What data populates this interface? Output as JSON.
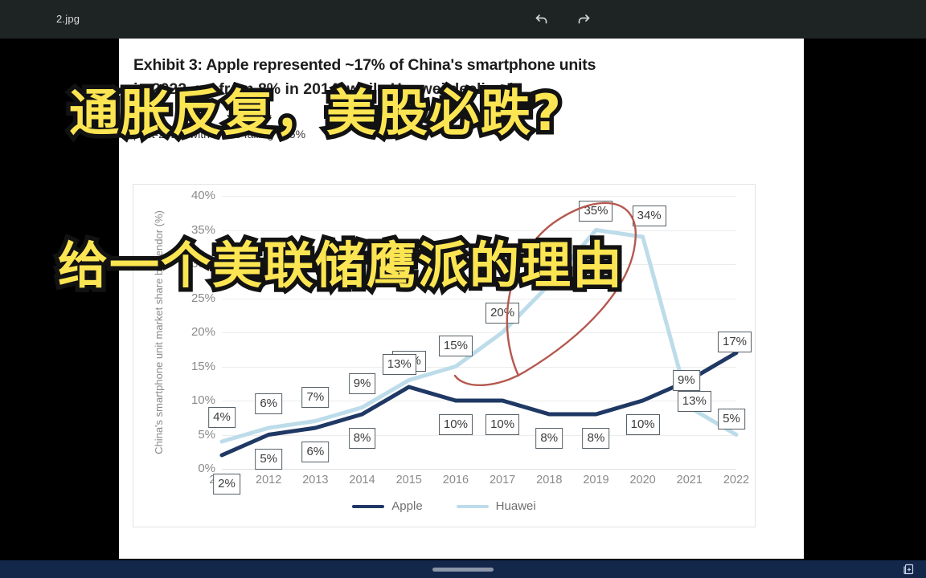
{
  "window": {
    "filename": "2.jpg",
    "undo_label": "undo-arrow",
    "redo_label": "redo-arrow"
  },
  "document": {
    "exhibit_title": "Exhibit 3: Apple represented ~17% of China's smartphone units",
    "exhibit_subtitle": "in 2022, up from 8% in 2014, while Huawei declined",
    "exhibit_note": "post-2020, with share falling to 5%"
  },
  "caption_overlay": {
    "line1": "通胀反复，美股必跌?",
    "line2": "给一个美联储鹰派的理由",
    "fill_color": "#FCE552",
    "stroke_color": "#121212"
  },
  "annotation": {
    "type": "hand-drawn-ellipse",
    "color": "#B5584F"
  },
  "system_bar": {
    "tray_icon": "duplicate-icon",
    "background": "#13274b"
  },
  "chart_data": {
    "type": "line",
    "title": "Exhibit 3: Apple represented ~17% of China's smartphone units",
    "xlabel": "",
    "ylabel": "China's smartphone unit market share by vendor (%)",
    "x": [
      "2011",
      "2012",
      "2013",
      "2014",
      "2015",
      "2016",
      "2017",
      "2018",
      "2019",
      "2020",
      "2021",
      "2022"
    ],
    "ylim": [
      0,
      40
    ],
    "yticks": [
      "0%",
      "5%",
      "10%",
      "15%",
      "20%",
      "25%",
      "30%",
      "35%",
      "40%"
    ],
    "ytick_values": [
      0,
      5,
      10,
      15,
      20,
      25,
      30,
      35,
      40
    ],
    "grid": true,
    "legend_position": "bottom",
    "series": [
      {
        "name": "Apple",
        "color": "#1F3864",
        "values": [
          2,
          5,
          6,
          8,
          12,
          10,
          10,
          8,
          8,
          10,
          13,
          17
        ],
        "labels": [
          "2%",
          "5%",
          "6%",
          "8%",
          "12%",
          "10%",
          "10%",
          "8%",
          "8%",
          "10%",
          "13%",
          "17%"
        ]
      },
      {
        "name": "Huawei",
        "color": "#BDDCEA",
        "values": [
          4,
          6,
          7,
          9,
          13,
          15,
          20,
          27,
          35,
          34,
          9,
          5
        ],
        "labels": [
          "4%",
          "6%",
          "7%",
          "9%",
          "13%",
          "15%",
          "20%",
          "",
          "35%",
          "34%",
          "9%",
          "5%"
        ]
      }
    ]
  }
}
